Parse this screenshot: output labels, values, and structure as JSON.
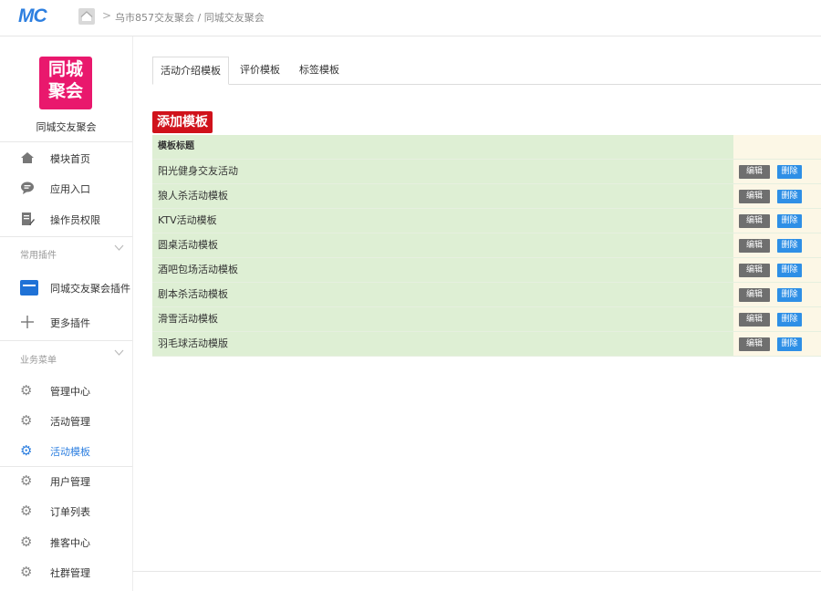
{
  "header": {
    "logo_text": "MC",
    "breadcrumb_sep": ">",
    "breadcrumb": "乌市857交友聚会 / 同城交友聚会"
  },
  "sidebar": {
    "brand_logo_line1": "同城",
    "brand_logo_line2": "聚会",
    "brand_name": "同城交友聚会",
    "top_items": [
      {
        "label": "模块首页",
        "icon": "home-icon"
      },
      {
        "label": "应用入口",
        "icon": "chat-icon"
      },
      {
        "label": "操作员权限",
        "icon": "edit-doc-icon"
      }
    ],
    "plugins_section": "常用插件",
    "plugins": [
      {
        "label": "同城交友聚会插件",
        "icon": "plugin-app-icon"
      },
      {
        "label": "更多插件",
        "icon": "plus-icon"
      }
    ],
    "business_section": "业务菜单",
    "business_items": [
      {
        "label": "管理中心",
        "icon": "gear-icon",
        "active": false
      },
      {
        "label": "活动管理",
        "icon": "gear-icon",
        "active": false
      },
      {
        "label": "活动模板",
        "icon": "gear-icon",
        "active": true
      },
      {
        "label": "用户管理",
        "icon": "gear-icon",
        "active": false
      },
      {
        "label": "订单列表",
        "icon": "gear-icon",
        "active": false
      },
      {
        "label": "推客中心",
        "icon": "gear-icon",
        "active": false
      },
      {
        "label": "社群管理",
        "icon": "gear-icon",
        "active": false
      }
    ]
  },
  "main": {
    "tabs": [
      {
        "label": "活动介绍模板",
        "active": true
      },
      {
        "label": "评价模板",
        "active": false
      },
      {
        "label": "标签模板",
        "active": false
      }
    ],
    "add_button": "添加模板",
    "table": {
      "header": "模板标题",
      "edit_label": "编辑",
      "delete_label": "删除",
      "rows": [
        "阳光健身交友活动",
        "狼人杀活动模板",
        "KTV活动模板",
        "圆桌活动模板",
        "酒吧包场活动模板",
        "剧本杀活动模板",
        "滑雪活动模板",
        "羽毛球活动模版"
      ]
    }
  },
  "colors": {
    "accent": "#2d7fe0",
    "brand_pink": "#e9186d",
    "add_red": "#d0121b",
    "row_green": "#deefd4",
    "ops_cream": "#fcf7e6"
  }
}
